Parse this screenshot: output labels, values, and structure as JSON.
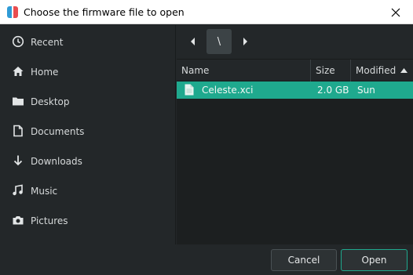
{
  "window": {
    "title": "Choose the firmware file to open"
  },
  "sidebar": {
    "items": [
      {
        "label": "Recent",
        "icon": "clock-icon"
      },
      {
        "label": "Home",
        "icon": "home-icon"
      },
      {
        "label": "Desktop",
        "icon": "folder-icon"
      },
      {
        "label": "Documents",
        "icon": "document-icon"
      },
      {
        "label": "Downloads",
        "icon": "download-icon"
      },
      {
        "label": "Music",
        "icon": "music-icon"
      },
      {
        "label": "Pictures",
        "icon": "camera-icon"
      }
    ]
  },
  "pathbar": {
    "segment": "\\"
  },
  "filelist": {
    "columns": {
      "name": "Name",
      "size": "Size",
      "modified": "Modified"
    },
    "sort_direction": "ascending",
    "rows": [
      {
        "name": "Celeste.xci",
        "size": "2.0 GB",
        "modified": "Sun",
        "selected": true
      }
    ]
  },
  "buttons": {
    "cancel": "Cancel",
    "open": "Open"
  },
  "colors": {
    "accent": "#1fa98e",
    "background": "#232729",
    "list_background": "#1c1f20"
  }
}
